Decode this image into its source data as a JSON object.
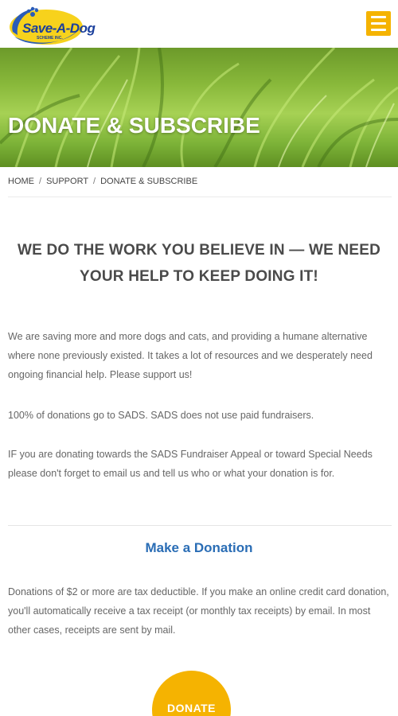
{
  "header": {
    "logo_text": "Save-A-Dog",
    "logo_subtext": "SCHEME INC.",
    "menu_icon": "hamburger-menu-icon",
    "accent_color": "#f5b301"
  },
  "hero": {
    "title": "DONATE & SUBSCRIBE"
  },
  "breadcrumb": {
    "items": [
      "HOME",
      "SUPPORT",
      "DONATE & SUBSCRIBE"
    ],
    "separator": "/"
  },
  "main": {
    "headline": "WE DO THE WORK YOU BELIEVE IN — WE NEED YOUR HELP TO KEEP DOING IT!",
    "paragraphs": [
      "We are saving more and more dogs and cats, and providing a humane alternative where none previously existed. It takes a lot of resources and we desperately need ongoing financial help. Please support us!",
      "100% of donations go to SADS. SADS does not use paid fundraisers.",
      "IF you are donating towards the SADS Fundraiser Appeal or toward Special Needs please don't forget to email us and tell us who or what your donation is for."
    ],
    "donation_section": {
      "title": "Make a Donation",
      "title_color": "#2a6db5",
      "text": "Donations of $2 or more are tax deductible. If you make an online credit card donation, you'll automatically receive a tax receipt (or monthly tax receipts) by email. In most other cases, receipts are sent by mail.",
      "button_label": "DONATE"
    }
  }
}
